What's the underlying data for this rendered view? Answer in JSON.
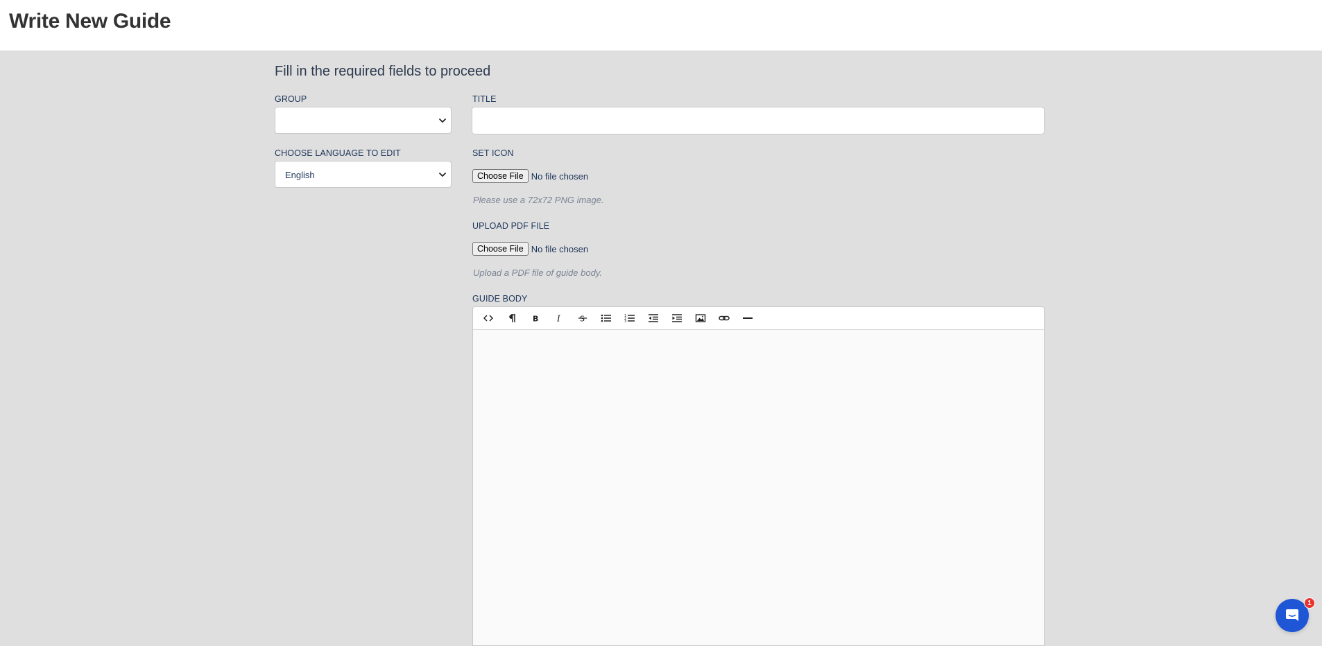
{
  "header": {
    "title": "Write New Guide"
  },
  "form": {
    "subtitle": "Fill in the required fields to proceed",
    "group_label": "GROUP",
    "group_value": "",
    "title_label": "TITLE",
    "title_value": "",
    "language_label": "CHOOSE LANGUAGE TO EDIT",
    "language_value": "English",
    "icon_label": "SET ICON",
    "icon_button": "Choose File",
    "icon_status": "No file chosen",
    "icon_help": "Please use a 72x72 PNG image.",
    "pdf_label": "UPLOAD PDF FILE",
    "pdf_button": "Choose File",
    "pdf_status": "No file chosen",
    "pdf_help": "Upload a PDF file of guide body.",
    "body_label": "GUIDE BODY"
  },
  "toolbar": {
    "buttons": [
      "code-view-icon",
      "paragraph-icon",
      "bold-icon",
      "italic-icon",
      "strikethrough-icon",
      "bullet-list-icon",
      "numbered-list-icon",
      "outdent-icon",
      "indent-icon",
      "image-icon",
      "link-icon",
      "horizontal-rule-icon"
    ]
  },
  "chat": {
    "badge_count": "1",
    "accent": "#1f56d6",
    "badge_color": "#e8322e"
  }
}
